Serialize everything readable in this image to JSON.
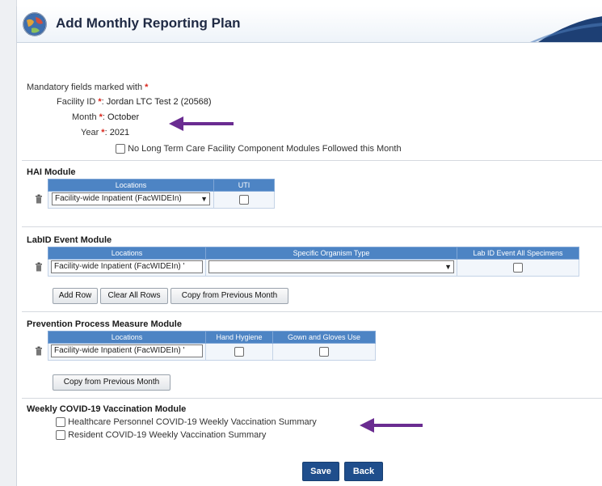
{
  "header": {
    "title": "Add Monthly Reporting Plan"
  },
  "form": {
    "mandatory_note": "Mandatory fields marked with",
    "required_mark": "*",
    "facility_label": "Facility ID",
    "facility_value": "Jordan LTC Test 2 (20568)",
    "month_label": "Month",
    "month_value": "October",
    "year_label": "Year",
    "year_value": "2021",
    "no_ltcf_label": "No Long Term Care Facility Component Modules Followed this Month",
    "colon": ":"
  },
  "hai": {
    "title": "HAI Module",
    "col_locations": "Locations",
    "col_uti": "UTI",
    "location_value": "Facility-wide Inpatient (FacWIDEIn)"
  },
  "labid": {
    "title": "LabID Event Module",
    "col_locations": "Locations",
    "col_organism": "Specific Organism Type",
    "col_all_specimens": "Lab ID Event All Specimens",
    "location_value": "Facility-wide Inpatient (FacWIDEIn) '",
    "organism_value": "",
    "add_row": "Add Row",
    "clear_all_rows": "Clear All Rows",
    "copy_prev": "Copy from Previous Month"
  },
  "prevention": {
    "title": "Prevention Process Measure Module",
    "col_locations": "Locations",
    "col_hand_hygiene": "Hand Hygiene",
    "col_gown_gloves": "Gown and Gloves Use",
    "location_value": "Facility-wide Inpatient (FacWIDEIn) '",
    "copy_prev": "Copy from Previous Month"
  },
  "covid": {
    "title": "Weekly COVID-19 Vaccination Module",
    "hcp_label": "Healthcare Personnel COVID-19 Weekly Vaccination Summary",
    "resident_label": "Resident COVID-19 Weekly Vaccination Summary"
  },
  "actions": {
    "save": "Save",
    "back": "Back"
  },
  "colors": {
    "accent": "#1f4e8c",
    "table_header": "#4d84c4",
    "annotation": "#6a2c91",
    "required": "#d9261c"
  },
  "icons": [
    "globe-logo-icon",
    "trash-icon",
    "dropdown-arrow-icon",
    "annotation-arrow-icon"
  ]
}
